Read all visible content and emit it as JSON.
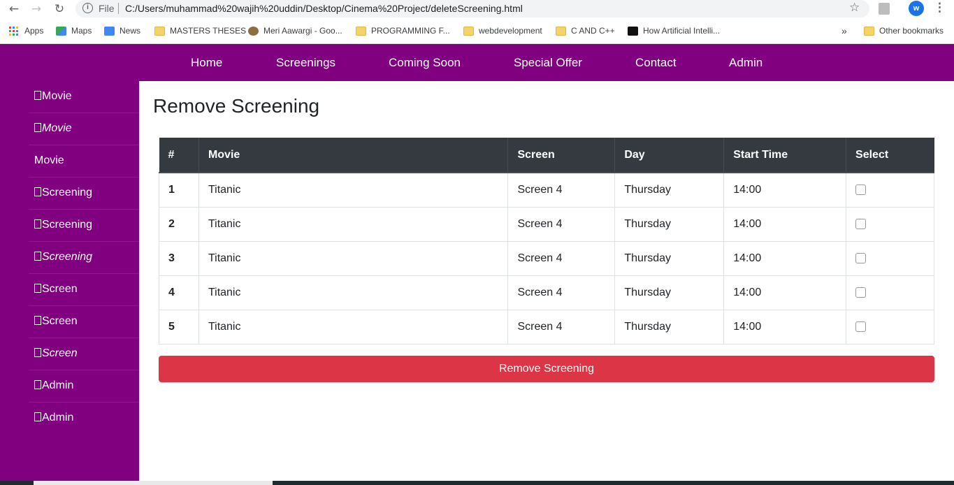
{
  "browser": {
    "back_icon": "arrow-left-icon",
    "forward_icon": "arrow-right-icon",
    "reload_icon": "reload-icon",
    "file_label": "File",
    "url": "C:/Users/muhammad%20wajih%20uddin/Desktop/Cinema%20Project/deleteScreening.html",
    "avatar_letter": "w",
    "bookmarks": [
      {
        "label": "Apps",
        "icon": "apps-grid-icon"
      },
      {
        "label": "Maps",
        "icon": "maps-icon"
      },
      {
        "label": "News",
        "icon": "news-icon"
      },
      {
        "label": "MASTERS THESES",
        "icon": "folder-icon"
      },
      {
        "label": "Meri Aawargi - Goo...",
        "icon": "site-favicon-icon"
      },
      {
        "label": "PROGRAMMING F...",
        "icon": "folder-icon"
      },
      {
        "label": "webdevelopment",
        "icon": "folder-icon"
      },
      {
        "label": "C AND C++",
        "icon": "folder-icon"
      },
      {
        "label": "How Artificial Intelli...",
        "icon": "site-favicon-icon"
      },
      {
        "label": "Other bookmarks",
        "icon": "folder-icon"
      }
    ],
    "overflow_label": "»"
  },
  "nav": {
    "links": [
      "Home",
      "Screenings",
      "Coming Soon",
      "Special Offer",
      "Contact",
      "Admin"
    ]
  },
  "sidebar": {
    "items": [
      {
        "label": "Movie",
        "italic": false,
        "glyph": true
      },
      {
        "label": "Movie",
        "italic": true,
        "glyph": true
      },
      {
        "label": "Movie",
        "italic": false,
        "glyph": false
      },
      {
        "label": "Screening",
        "italic": false,
        "glyph": true
      },
      {
        "label": "Screening",
        "italic": false,
        "glyph": true
      },
      {
        "label": "Screening",
        "italic": true,
        "glyph": true
      },
      {
        "label": "Screen",
        "italic": false,
        "glyph": true
      },
      {
        "label": "Screen",
        "italic": false,
        "glyph": true
      },
      {
        "label": "Screen",
        "italic": true,
        "glyph": true
      },
      {
        "label": "Admin",
        "italic": false,
        "glyph": true
      },
      {
        "label": "Admin",
        "italic": false,
        "glyph": true
      }
    ]
  },
  "main": {
    "title": "Remove Screening",
    "table": {
      "headers": [
        "#",
        "Movie",
        "Screen",
        "Day",
        "Start Time",
        "Select"
      ],
      "rows": [
        {
          "num": "1",
          "movie": "Titanic",
          "screen": "Screen 4",
          "day": "Thursday",
          "start": "14:00",
          "selected": false
        },
        {
          "num": "2",
          "movie": "Titanic",
          "screen": "Screen 4",
          "day": "Thursday",
          "start": "14:00",
          "selected": false
        },
        {
          "num": "3",
          "movie": "Titanic",
          "screen": "Screen 4",
          "day": "Thursday",
          "start": "14:00",
          "selected": false
        },
        {
          "num": "4",
          "movie": "Titanic",
          "screen": "Screen 4",
          "day": "Thursday",
          "start": "14:00",
          "selected": false
        },
        {
          "num": "5",
          "movie": "Titanic",
          "screen": "Screen 4",
          "day": "Thursday",
          "start": "14:00",
          "selected": false
        }
      ]
    },
    "button_label": "Remove Screening"
  },
  "colors": {
    "brand_purple": "#800080",
    "table_header": "#343a40",
    "danger": "#dc3545"
  }
}
